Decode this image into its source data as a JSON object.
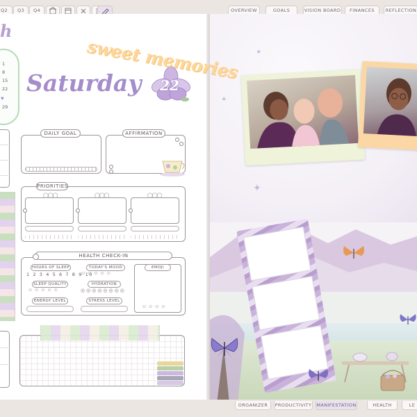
{
  "top_tabs": {
    "left": [
      "Q2",
      "Q3",
      "Q4"
    ],
    "right": [
      "OVERVIEW",
      "GOALS",
      "VISION BOARD",
      "FINANCES",
      "REFLECTION"
    ]
  },
  "bottom_tabs": [
    "ORGANIZER",
    "PRODUCTIVITY",
    "MANIFESTATION",
    "HEALTH",
    "LE"
  ],
  "month_fragment": "h",
  "mini_calendar": [
    "1",
    "8",
    "15",
    "22",
    "29"
  ],
  "day": {
    "name": "Saturday",
    "date": "22"
  },
  "sections": {
    "daily_goal": "DAILY GOAL",
    "affirmation": "AFFIRMATION",
    "priorities": "PRIORITIES",
    "health_checkin": "HEALTH CHECK-IN"
  },
  "health": {
    "hours_of_sleep": "HOURS OF SLEEP",
    "sleep_numbers": "1 2 3 4 5 6 7 8 9 10",
    "todays_mood": "TODAY'S MOOD",
    "emoji": "EMOJI",
    "sleep_quality": "SLEEP QUALITY",
    "hydration": "HYDRATION",
    "energy_level": "ENERGY LEVEL",
    "stress_level": "STRESS LEVEL"
  },
  "memories": {
    "title": "sweet memories"
  },
  "colors": {
    "accent_lavender": "#a58ccb",
    "calendar_green": "#b9d8b7",
    "memories_peach": "#fcd79a"
  }
}
